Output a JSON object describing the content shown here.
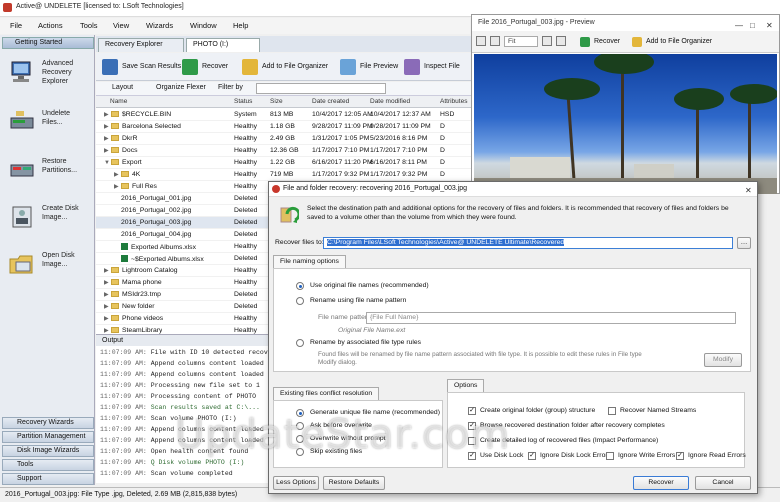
{
  "app": {
    "title": "Active@ UNDELETE [licensed to: LSoft Technologies]",
    "menu": [
      "File",
      "Actions",
      "Tools",
      "View",
      "Wizards",
      "Window",
      "Help"
    ]
  },
  "sidebar": {
    "header": "Getting Started",
    "items": [
      {
        "label": "Advanced Recovery Explorer",
        "icon": "computer-icon"
      },
      {
        "label": "Undelete Files...",
        "icon": "drive-undelete-icon"
      },
      {
        "label": "Restore Partitions...",
        "icon": "restore-partition-icon"
      },
      {
        "label": "Create Disk Image...",
        "icon": "disk-image-icon"
      },
      {
        "label": "Open Disk Image...",
        "icon": "open-image-icon"
      }
    ],
    "bottom": [
      "Recovery Wizards",
      "Partition Management",
      "Disk Image Wizards",
      "Tools",
      "Support"
    ]
  },
  "tabs": [
    "Recovery Explorer",
    "PHOTO (I:)"
  ],
  "toolbar": [
    "Save Scan Results",
    "Recover",
    "Add to File Organizer",
    "File Preview",
    "Inspect File Records"
  ],
  "filterbar": {
    "layout": "Layout",
    "organize": "Organize Flexer",
    "filter": "Filter by"
  },
  "grid": {
    "columns": [
      "Name",
      "Status",
      "Size",
      "Date created",
      "Date modified",
      "Attributes"
    ],
    "rows": [
      {
        "type": "folder",
        "indent": 1,
        "name": "$RECYCLE.BIN",
        "status": "System",
        "size": "813 MB",
        "created": "10/4/2017 12:05 AM",
        "modified": "10/4/2017 12:37 AM",
        "attr": "HSD"
      },
      {
        "type": "folder",
        "indent": 1,
        "name": "Barcelona Selected",
        "status": "Healthy",
        "size": "1.18 GB",
        "created": "9/28/2017 11:09 PM",
        "modified": "9/28/2017 11:09 PM",
        "attr": "D"
      },
      {
        "type": "folder",
        "indent": 1,
        "name": "DkrR",
        "status": "Healthy",
        "size": "2.49 GB",
        "created": "1/31/2017 1:05 PM",
        "modified": "5/23/2016 8:16 PM",
        "attr": "D"
      },
      {
        "type": "folder",
        "indent": 1,
        "name": "Docs",
        "status": "Healthy",
        "size": "12.36 GB",
        "created": "1/17/2017 7:10 PM",
        "modified": "1/17/2017 7:10 PM",
        "attr": "D"
      },
      {
        "type": "folder",
        "indent": 1,
        "name": "Export",
        "status": "Healthy",
        "size": "1.22 GB",
        "created": "6/16/2017 11:20 PM",
        "modified": "6/16/2017 8:11 PM",
        "attr": "D",
        "open": true
      },
      {
        "type": "folder",
        "indent": 2,
        "name": "4K",
        "status": "Healthy",
        "size": "719 MB",
        "created": "1/17/2017 9:32 PM",
        "modified": "1/17/2017 9:32 PM",
        "attr": "D"
      },
      {
        "type": "folder",
        "indent": 2,
        "name": "Full Res",
        "status": "Healthy",
        "size": "543 MB",
        "created": "1/17/2017 9:32 PM",
        "modified": "1/17/2017 9:32 PM",
        "attr": "D"
      },
      {
        "type": "file",
        "indent": 2,
        "name": "2016_Portugal_001.jpg",
        "status": "Deleted",
        "size": "",
        "created": "",
        "modified": "",
        "attr": ""
      },
      {
        "type": "file",
        "indent": 2,
        "name": "2016_Portugal_002.jpg",
        "status": "Deleted",
        "size": "",
        "created": "",
        "modified": "",
        "attr": ""
      },
      {
        "type": "file",
        "indent": 2,
        "name": "2016_Portugal_003.jpg",
        "status": "Deleted",
        "size": "",
        "created": "",
        "modified": "",
        "attr": "",
        "selected": true
      },
      {
        "type": "file",
        "indent": 2,
        "name": "2016_Portugal_004.jpg",
        "status": "Deleted",
        "size": "",
        "created": "",
        "modified": "",
        "attr": ""
      },
      {
        "type": "xl",
        "indent": 2,
        "name": "Exported Albums.xlsx",
        "status": "Healthy",
        "size": "",
        "created": "",
        "modified": "",
        "attr": ""
      },
      {
        "type": "xl",
        "indent": 2,
        "name": "~$Exported Albums.xlsx",
        "status": "Deleted",
        "size": "",
        "created": "",
        "modified": "",
        "attr": ""
      },
      {
        "type": "folder",
        "indent": 1,
        "name": "Lightroom Catalog",
        "status": "Healthy",
        "size": "",
        "created": "",
        "modified": "",
        "attr": ""
      },
      {
        "type": "folder",
        "indent": 1,
        "name": "Mama phone",
        "status": "Healthy",
        "size": "",
        "created": "",
        "modified": "",
        "attr": ""
      },
      {
        "type": "folder",
        "indent": 1,
        "name": "MSIdr23.tmp",
        "status": "Deleted",
        "size": "",
        "created": "",
        "modified": "",
        "attr": ""
      },
      {
        "type": "folder",
        "indent": 1,
        "name": "New folder",
        "status": "Deleted",
        "size": "",
        "created": "",
        "modified": "",
        "attr": ""
      },
      {
        "type": "folder",
        "indent": 1,
        "name": "Phone videos",
        "status": "Healthy",
        "size": "",
        "created": "",
        "modified": "",
        "attr": ""
      },
      {
        "type": "folder",
        "indent": 1,
        "name": "SteamLibrary",
        "status": "Healthy",
        "size": "",
        "created": "",
        "modified": "",
        "attr": ""
      }
    ]
  },
  "output": {
    "title": "Output",
    "lines": [
      {
        "t": "11:07:09 AM:",
        "msg": "File with ID 10 detected recovery",
        "green": false
      },
      {
        "t": "11:07:09 AM:",
        "msg": "Append columns content loaded",
        "green": false
      },
      {
        "t": "11:07:09 AM:",
        "msg": "Append columns content loaded",
        "green": false
      },
      {
        "t": "11:07:09 AM:",
        "msg": "Processing new file set to 1",
        "green": false
      },
      {
        "t": "11:07:09 AM:",
        "msg": "Processing content of PHOTO",
        "green": false
      },
      {
        "t": "11:07:09 AM:",
        "msg": "Scan results saved at C:\\...",
        "green": true
      },
      {
        "t": "11:07:09 AM:",
        "msg": "Scan volume PHOTO (I:)",
        "green": false
      },
      {
        "t": "11:07:09 AM:",
        "msg": "Append columns content loaded",
        "green": false
      },
      {
        "t": "11:07:09 AM:",
        "msg": "Append columns content loaded",
        "green": false
      },
      {
        "t": "11:07:09 AM:",
        "msg": "Open health content found",
        "green": false
      },
      {
        "t": "11:07:09 AM:",
        "msg": "Q Disk volume PHOTO (I:)",
        "green": true
      },
      {
        "t": "11:07:09 AM:",
        "msg": "Scan volume completed",
        "green": false
      }
    ]
  },
  "status": "2016_Portugal_003.jpg: File Type .jpg, Deleted, 2.69 MB (2,815,838 bytes)",
  "preview": {
    "title": "File 2016_Portugal_003.jpg - Preview",
    "zoom": "Fit",
    "recover": "Recover",
    "add": "Add to File Organizer"
  },
  "dialog": {
    "title": "File and folder recovery: recovering 2016_Portugal_003.jpg",
    "description": "Select the destination path and additional options for the recovery of files and folders.  It is recommended that recovery of files and folders be saved to a volume other than the volume from which they were found.",
    "recover_to_label": "Recover files to:",
    "recover_to_value": "C:\\Program Files\\LSoft Technologies\\Active@ UNDELETE Ultimate\\Recovered",
    "naming_tab": "File naming options",
    "naming": {
      "opt1": "Use original file names (recommended)",
      "opt2": "Rename using file name pattern",
      "pattern_label": "File name pattern:",
      "pattern_value": "{File Full Name}",
      "pattern_hint": "Original File Name.ext",
      "opt3": "Rename by associated file type rules",
      "opt3_hint": "Found files will be renamed by file name pattern associated with file type. It is possible to edit these rules in File type Modify dialog.",
      "modify": "Modify"
    },
    "conflict_tab": "Existing files conflict resolution",
    "conflict": [
      "Generate unique file name (recommended)",
      "Ask before overwrite",
      "Overwrite without prompt",
      "Skip existing files"
    ],
    "options_tab": "Options",
    "options": [
      {
        "label": "Create original folder (group) structure",
        "checked": true
      },
      {
        "label": "Recover Named Streams",
        "checked": false
      },
      {
        "label": "Browse recovered destination folder after recovery completes",
        "checked": true
      },
      {
        "label": "Create detailed log of recovered files (Impact Performance)",
        "checked": false
      },
      {
        "label": "Use Disk Lock",
        "checked": true
      },
      {
        "label": "Ignore Disk Lock Errors",
        "checked": true
      },
      {
        "label": "Ignore Write Errors",
        "checked": false
      },
      {
        "label": "Ignore Read Errors",
        "checked": true
      }
    ],
    "buttons": {
      "less": "Less Options",
      "restore": "Restore Defaults",
      "recover": "Recover",
      "cancel": "Cancel"
    }
  },
  "watermark": "UpdateStar.com",
  "colors": {
    "accent": "#2f6fd0",
    "sidebar": "#e8ecf2"
  }
}
